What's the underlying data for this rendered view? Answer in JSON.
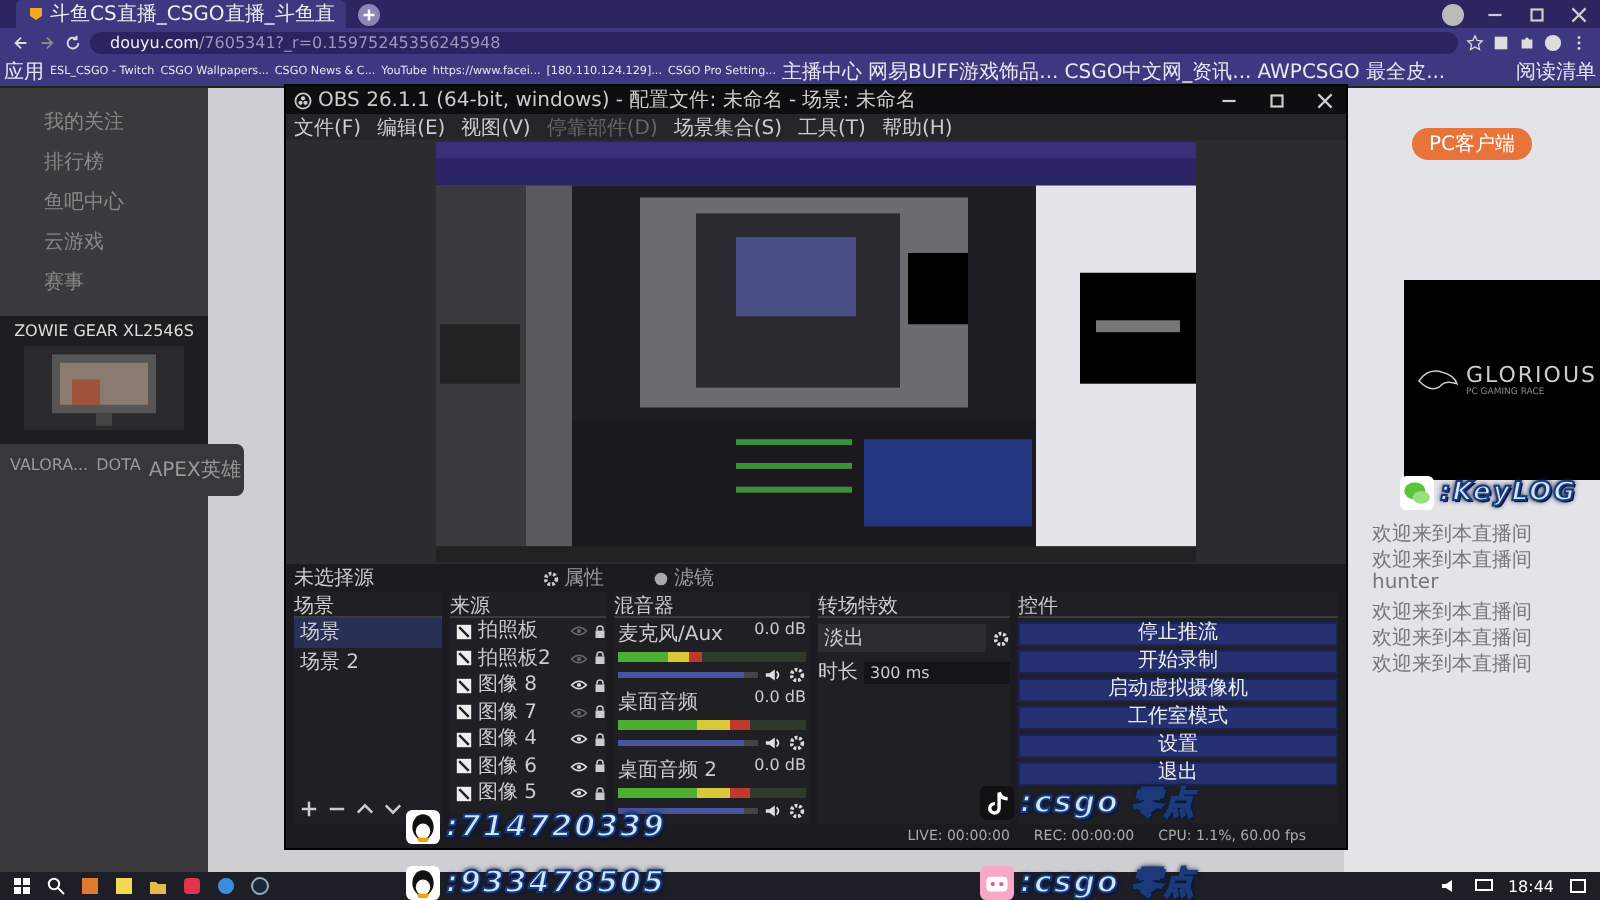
{
  "browser": {
    "tab_title": "斗鱼CS直播_CSGO直播_斗鱼直",
    "url_host": "douyu.com",
    "url_path": "/7605341?_r=0.15975245356245948",
    "bookmarks": [
      "应用",
      "ESL_CSGO - Twitch",
      "CSGO Wallpapers...",
      "CSGO News & C...",
      "YouTube",
      "https://www.facei...",
      "[180.110.124.129]...",
      "CSGO Pro Setting...",
      "主播中心",
      "网易BUFF游戏饰品...",
      "CSGO中文网_资讯...",
      "AWPCSGO 最全皮..."
    ],
    "reading_list": "阅读清单"
  },
  "site_sidebar": {
    "items": [
      "我的关注",
      "排行榜",
      "鱼吧中心",
      "云游戏",
      "赛事"
    ],
    "banner": "ZOWIE GEAR XL2546S",
    "categories": [
      "VALORA...",
      "DOTA",
      "APEX英雄"
    ]
  },
  "site_right": {
    "client_button": "PC客户端",
    "chat": [
      "欢迎来到本直播间",
      "欢迎来到本直播间",
      "hunter",
      "欢迎来到本直播间",
      "欢迎来到本直播间",
      "欢迎来到本直播间"
    ]
  },
  "obs": {
    "title": "OBS 26.1.1 (64-bit, windows) - 配置文件: 未命名 - 场景: 未命名",
    "menu": [
      {
        "label": "文件(F)",
        "disabled": false
      },
      {
        "label": "编辑(E)",
        "disabled": false
      },
      {
        "label": "视图(V)",
        "disabled": false
      },
      {
        "label": "停靠部件(D)",
        "disabled": true
      },
      {
        "label": "场景集合(S)",
        "disabled": false
      },
      {
        "label": "工具(T)",
        "disabled": false
      },
      {
        "label": "帮助(H)",
        "disabled": false
      }
    ],
    "source_bar": {
      "label": "未选择源",
      "properties": "属性",
      "filters": "滤镜"
    },
    "scenes": {
      "title": "场景",
      "items": [
        {
          "label": "场景",
          "selected": true
        },
        {
          "label": "场景 2",
          "selected": false
        }
      ]
    },
    "sources": {
      "title": "来源",
      "items": [
        {
          "label": "拍照板",
          "visible": false
        },
        {
          "label": "拍照板2",
          "visible": false
        },
        {
          "label": "图像 8",
          "visible": true
        },
        {
          "label": "图像 7",
          "visible": false
        },
        {
          "label": "图像 4",
          "visible": true
        },
        {
          "label": "图像 6",
          "visible": true
        },
        {
          "label": "图像 5",
          "visible": true
        }
      ]
    },
    "mixer": {
      "title": "混音器",
      "channels": [
        {
          "name": "麦克风/Aux",
          "reading": "0.0 dB",
          "level": 0.45,
          "volume": {
            "level": 0.9
          }
        },
        {
          "name": "桌面音频",
          "reading": "0.0 dB",
          "level": 0.7,
          "volume": {
            "level": 0.9
          }
        },
        {
          "name": "桌面音频 2",
          "reading": "0.0 dB",
          "level": 0.7,
          "volume": {
            "level": 0.9
          }
        }
      ]
    },
    "transitions": {
      "title": "转场特效",
      "type": "淡出",
      "duration_label": "时长",
      "duration": "300 ms"
    },
    "controls": {
      "title": "控件",
      "buttons": [
        "停止推流",
        "开始录制",
        "启动虚拟摄像机",
        "工作室模式",
        "设置",
        "退出"
      ]
    },
    "status": {
      "live": "LIVE: 00:00:00",
      "rec": "REC: 00:00:00",
      "cpu": "CPU: 1.1%, 60.00 fps"
    }
  },
  "overlays": {
    "qq": [
      ":714720339",
      ":933478505"
    ],
    "handles": [
      {
        "kind": "tiktok",
        "text": ":csgo 零点"
      },
      {
        "kind": "pink",
        "text": ":csgo 零点"
      }
    ],
    "wechat": ":KeyLOG",
    "logo": {
      "name": "GLORIOUS",
      "tagline": "PC GAMING RACE"
    }
  },
  "taskbar": {
    "time": "18:44"
  }
}
